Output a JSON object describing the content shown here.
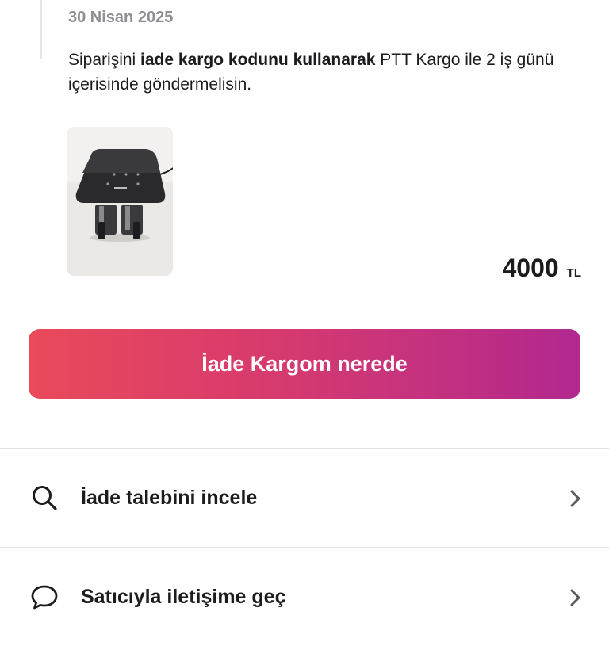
{
  "order": {
    "date": "30 Nisan 2025",
    "message": {
      "part1": "Siparişini ",
      "bold": "iade kargo kodunu kullanarak",
      "part2": " PTT Kargo ile 2 iş günü içerisinde göndermelisin."
    },
    "product": {
      "image_icon": "air-fryer-product-photo",
      "price": "4000",
      "currency": "TL"
    }
  },
  "cta": {
    "label": "İade Kargom nerede",
    "gradient_start": "#ea4a5a",
    "gradient_end": "#b2288f"
  },
  "menu": {
    "items": [
      {
        "label": "İade talebini incele",
        "icon": "search-icon"
      },
      {
        "label": "Satıcıyla iletişime geç",
        "icon": "chat-bubble-icon"
      }
    ]
  }
}
